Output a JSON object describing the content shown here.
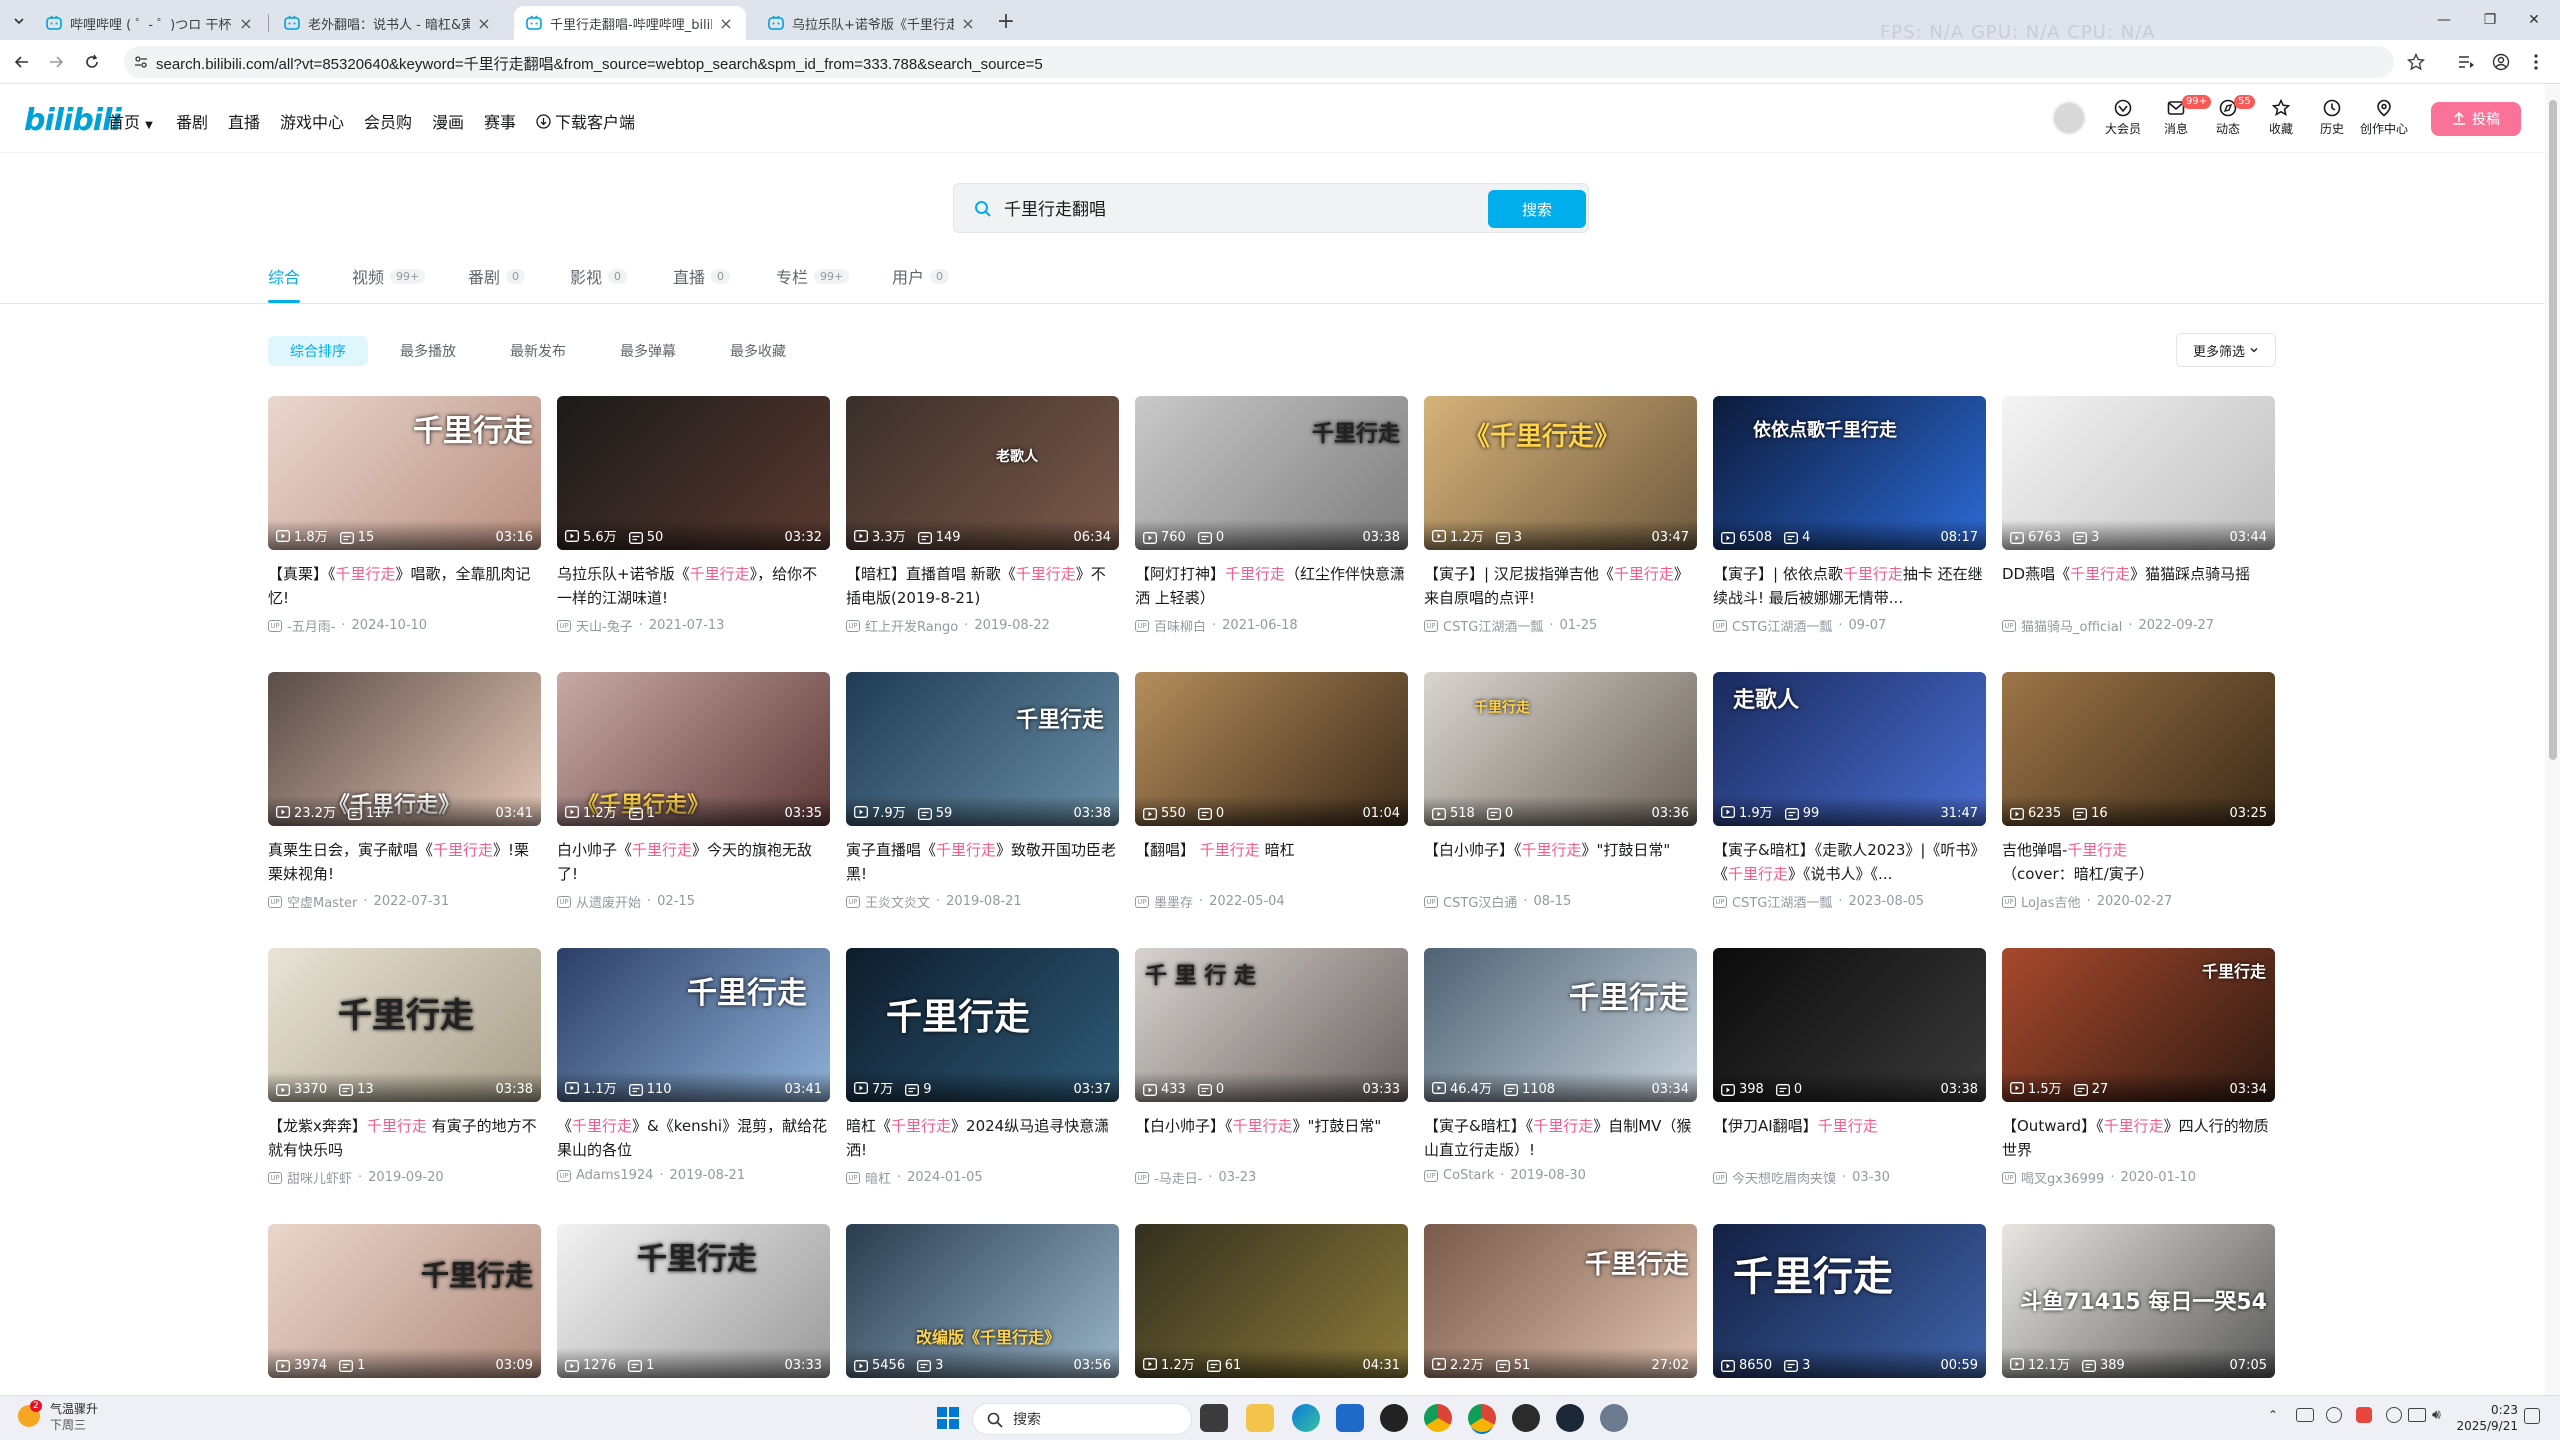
{
  "browser": {
    "tabs": [
      {
        "title": "哔哩哔哩 ( ゜- ゜)つロ 干杯~-bi",
        "active": false,
        "close": "×"
      },
      {
        "title": "老外翻唱：说书人 - 暗杠&寅子",
        "active": false,
        "close": "×"
      },
      {
        "title": "千里行走翻唱-哔哩哔哩_bilibili",
        "active": true,
        "close": "×"
      },
      {
        "title": "乌拉乐队+诺爷版《千里行走》",
        "active": false,
        "close": "×"
      }
    ],
    "new_tab": "+",
    "ghost_stats": "FPS: N/A     GPU: N/A     CPU: N/A",
    "url": "search.bilibili.com/all?vt=85320640&keyword=千里行走翻唱&from_source=webtop_search&spm_id_from=333.788&search_source=5",
    "window_controls": [
      "—",
      "❐",
      "✕"
    ]
  },
  "header": {
    "logo": "bilibili",
    "nav": [
      "首页",
      "番剧",
      "直播",
      "游戏中心",
      "会员购",
      "漫画",
      "赛事",
      "下载客户端"
    ],
    "icons": [
      {
        "label": "大会员",
        "icon": "vip-icon",
        "badge": ""
      },
      {
        "label": "消息",
        "icon": "message-icon",
        "badge": "99+"
      },
      {
        "label": "动态",
        "icon": "dynamic-icon",
        "badge": "55"
      },
      {
        "label": "收藏",
        "icon": "favorite-icon",
        "badge": ""
      },
      {
        "label": "历史",
        "icon": "history-icon",
        "badge": ""
      },
      {
        "label": "创作中心",
        "icon": "creator-icon",
        "badge": ""
      }
    ],
    "upload": "投稿"
  },
  "search": {
    "value": "千里行走翻唱",
    "button": "搜索"
  },
  "categories": [
    {
      "label": "综合",
      "count": "",
      "active": true
    },
    {
      "label": "视频",
      "count": "99+",
      "active": false
    },
    {
      "label": "番剧",
      "count": "0",
      "active": false
    },
    {
      "label": "影视",
      "count": "0",
      "active": false
    },
    {
      "label": "直播",
      "count": "0",
      "active": false
    },
    {
      "label": "专栏",
      "count": "99+",
      "active": false
    },
    {
      "label": "用户",
      "count": "0",
      "active": false
    }
  ],
  "sort": {
    "options": [
      "综合排序",
      "最多播放",
      "最新发布",
      "最多弹幕",
      "最多收藏"
    ],
    "active": 0,
    "more_filters": "更多筛选"
  },
  "videos": [
    {
      "views": "1.8万",
      "danmaku": "15",
      "duration": "03:16",
      "title": "【真栗】《千里行走》唱歌，全靠肌肉记忆!",
      "uploader": "-五月雨-",
      "date": "2024-10-10",
      "overlay": "千里行走"
    },
    {
      "views": "5.6万",
      "danmaku": "50",
      "duration": "03:32",
      "title": "乌拉乐队+诺爷版《千里行走》，给你不一样的江湖味道!",
      "uploader": "天山-兔子",
      "date": "2021-07-13",
      "overlay": ""
    },
    {
      "views": "3.3万",
      "danmaku": "149",
      "duration": "06:34",
      "title": "【暗杠】直播首唱 新歌《千里行走》不插电版(2019-8-21)",
      "uploader": "红上开发Rango",
      "date": "2019-08-22",
      "overlay": "老歌人"
    },
    {
      "views": "760",
      "danmaku": "0",
      "duration": "03:38",
      "title": "【阿灯打神】千里行走（红尘作伴快意潇洒 上轻裘）",
      "uploader": "百味柳白",
      "date": "2021-06-18",
      "overlay": "千里行走"
    },
    {
      "views": "1.2万",
      "danmaku": "3",
      "duration": "03:47",
      "title": "【寅子】| 汉尼拔指弹吉他《千里行走》来自原唱的点评!",
      "uploader": "CSTG江湖酒一瓢",
      "date": "01-25",
      "overlay": "《千里行走》"
    },
    {
      "views": "6508",
      "danmaku": "4",
      "duration": "08:17",
      "title": "【寅子】| 依依点歌千里行走抽卡 还在继续战斗! 最后被娜娜无情带...",
      "uploader": "CSTG江湖酒一瓢",
      "date": "09-07",
      "overlay": "依依点歌千里行走"
    },
    {
      "views": "6763",
      "danmaku": "3",
      "duration": "03:44",
      "title": "DD燕唱《千里行走》猫猫踩点骑马摇",
      "uploader": "猫猫骑马_official",
      "date": "2022-09-27",
      "overlay": ""
    },
    {
      "views": "23.2万",
      "danmaku": "117",
      "duration": "03:41",
      "title": "真栗生日会，寅子献唱《千里行走》!栗栗妹视角!",
      "uploader": "空虚Master",
      "date": "2022-07-31",
      "overlay": "《千里行走》"
    },
    {
      "views": "1.2万",
      "danmaku": "1",
      "duration": "03:35",
      "title": "白小帅子《千里行走》今天的旗袍无敌了!",
      "uploader": "从遗废开始",
      "date": "02-15",
      "overlay": "《千里行走》"
    },
    {
      "views": "7.9万",
      "danmaku": "59",
      "duration": "03:38",
      "title": "寅子直播唱《千里行走》致敬开国功臣老黑!",
      "uploader": "王炎文炎文",
      "date": "2019-08-21",
      "overlay": "千里行走"
    },
    {
      "views": "550",
      "danmaku": "0",
      "duration": "01:04",
      "title": "【翻唱】 千里行走 暗杠",
      "uploader": "墨墨存",
      "date": "2022-05-04",
      "overlay": ""
    },
    {
      "views": "518",
      "danmaku": "0",
      "duration": "03:36",
      "title": "【白小帅子】《千里行走》\"打鼓日常\"",
      "uploader": "CSTG汉白通",
      "date": "08-15",
      "overlay": "千里行走"
    },
    {
      "views": "1.9万",
      "danmaku": "99",
      "duration": "31:47",
      "title": "【寅子&暗杠】《走歌人2023》|《听书》《千里行走》《说书人》《...",
      "uploader": "CSTG江湖酒一瓢",
      "date": "2023-08-05",
      "overlay": "走歌人"
    },
    {
      "views": "6235",
      "danmaku": "16",
      "duration": "03:25",
      "title": "吉他弹唱-千里行走（cover：暗杠/寅子）",
      "uploader": "LoJas吉他",
      "date": "2020-02-27",
      "overlay": ""
    },
    {
      "views": "3370",
      "danmaku": "13",
      "duration": "03:38",
      "title": "【龙紫x奔奔】千里行走 有寅子的地方不就有快乐吗",
      "uploader": "甜咪儿虾虾",
      "date": "2019-09-20",
      "overlay": "千里行走"
    },
    {
      "views": "1.1万",
      "danmaku": "110",
      "duration": "03:41",
      "title": "《千里行走》&《kenshi》混剪，献给花果山的各位",
      "uploader": "Adams1924",
      "date": "2019-08-21",
      "overlay": "千里行走"
    },
    {
      "views": "7万",
      "danmaku": "9",
      "duration": "03:37",
      "title": "暗杠《千里行走》2024纵马追寻快意潇洒!",
      "uploader": "暗杠",
      "date": "2024-01-05",
      "overlay": "千里行走"
    },
    {
      "views": "433",
      "danmaku": "0",
      "duration": "03:33",
      "title": "【白小帅子】《千里行走》\"打鼓日常\"",
      "uploader": "-马走日-",
      "date": "03-23",
      "overlay": "千 里 行 走"
    },
    {
      "views": "46.4万",
      "danmaku": "1108",
      "duration": "03:34",
      "title": "【寅子&暗杠】《千里行走》自制MV（猴山直立行走版）!",
      "uploader": "CoStark",
      "date": "2019-08-30",
      "overlay": "千里行走"
    },
    {
      "views": "398",
      "danmaku": "0",
      "duration": "03:38",
      "title": "【伊刀AI翻唱】千里行走",
      "uploader": "今天想吃眉肉夹馍",
      "date": "03-30",
      "overlay": ""
    },
    {
      "views": "1.5万",
      "danmaku": "27",
      "duration": "03:34",
      "title": "【Outward】《千里行走》四人行的物质世界",
      "uploader": "喝叉gx36999",
      "date": "2020-01-10",
      "overlay": "千里行走"
    },
    {
      "views": "3974",
      "danmaku": "1",
      "duration": "03:09",
      "title": "",
      "uploader": "",
      "date": "",
      "overlay": "千里行走"
    },
    {
      "views": "1276",
      "danmaku": "1",
      "duration": "03:33",
      "title": "",
      "uploader": "",
      "date": "",
      "overlay": "千里行走"
    },
    {
      "views": "5456",
      "danmaku": "3",
      "duration": "03:56",
      "title": "",
      "uploader": "",
      "date": "",
      "overlay": "改编版《千里行走》"
    },
    {
      "views": "1.2万",
      "danmaku": "61",
      "duration": "04:31",
      "title": "",
      "uploader": "",
      "date": "",
      "overlay": ""
    },
    {
      "views": "2.2万",
      "danmaku": "51",
      "duration": "27:02",
      "title": "",
      "uploader": "",
      "date": "",
      "overlay": "千里行走"
    },
    {
      "views": "8650",
      "danmaku": "3",
      "duration": "00:59",
      "title": "",
      "uploader": "",
      "date": "",
      "overlay": "千里行走"
    },
    {
      "views": "12.1万",
      "danmaku": "389",
      "duration": "07:05",
      "title": "",
      "uploader": "",
      "date": "",
      "overlay": "斗鱼71415 每日一哭54"
    }
  ],
  "highlight_keyword": "千里行走",
  "taskbar": {
    "weather": "气温骤升",
    "weather_sub": "下周三",
    "weather_badge": "2",
    "search": "搜索",
    "time": "0:23",
    "date": "2025/9/21"
  },
  "colors": {
    "accent": "#00aeec",
    "pink": "#fb7299",
    "highlight": "#f25d8e"
  }
}
